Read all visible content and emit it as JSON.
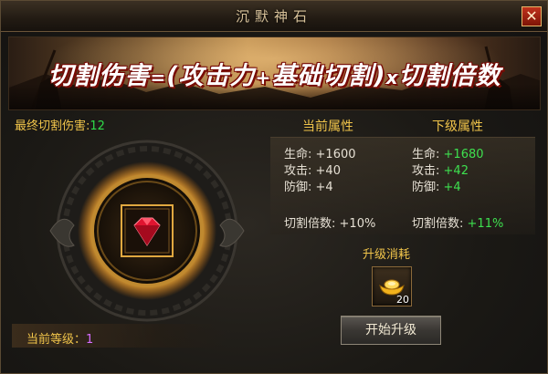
{
  "window": {
    "title": "沉默神石",
    "close_glyph": "✕"
  },
  "banner": {
    "formula": [
      "切割伤害",
      "=",
      "(攻击力",
      "+",
      "基础切割)",
      "x",
      "切割倍数"
    ]
  },
  "final_damage": {
    "label": "最终切割伤害:",
    "value": "12"
  },
  "attributes": {
    "current_header": "当前属性",
    "next_header": "下级属性",
    "current": [
      {
        "label": "生命:",
        "value": "+1600"
      },
      {
        "label": "攻击:",
        "value": "+40"
      },
      {
        "label": "防御:",
        "value": "+4"
      },
      {
        "label": "切割倍数:",
        "value": "+10%"
      }
    ],
    "next": [
      {
        "label": "生命:",
        "value": "+1680"
      },
      {
        "label": "攻击:",
        "value": "+42"
      },
      {
        "label": "防御:",
        "value": "+4"
      },
      {
        "label": "切割倍数:",
        "value": "+11%"
      }
    ]
  },
  "upgrade_cost": {
    "label": "升级消耗",
    "item_icon": "gold-ingot-icon",
    "count": "20"
  },
  "level": {
    "label": "当前等级：",
    "value": "1"
  },
  "actions": {
    "upgrade_label": "开始升级"
  },
  "colors": {
    "gold_text": "#f0c44a",
    "green_value": "#3ee04f",
    "purple_value": "#d66cff",
    "gem_red": "#e01430"
  }
}
